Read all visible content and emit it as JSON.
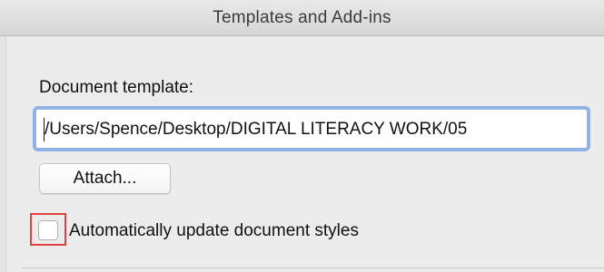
{
  "window": {
    "title": "Templates and Add-ins"
  },
  "template_section": {
    "label": "Document template:",
    "path_value": "/Users/Spence/Desktop/DIGITAL LITERACY WORK/05",
    "attach_label": "Attach..."
  },
  "options": {
    "auto_update_label": "Automatically update document styles",
    "auto_update_checked": false
  },
  "colors": {
    "focus_ring": "#8db2ea",
    "highlight_box": "#e0413a",
    "background": "#ececec"
  }
}
